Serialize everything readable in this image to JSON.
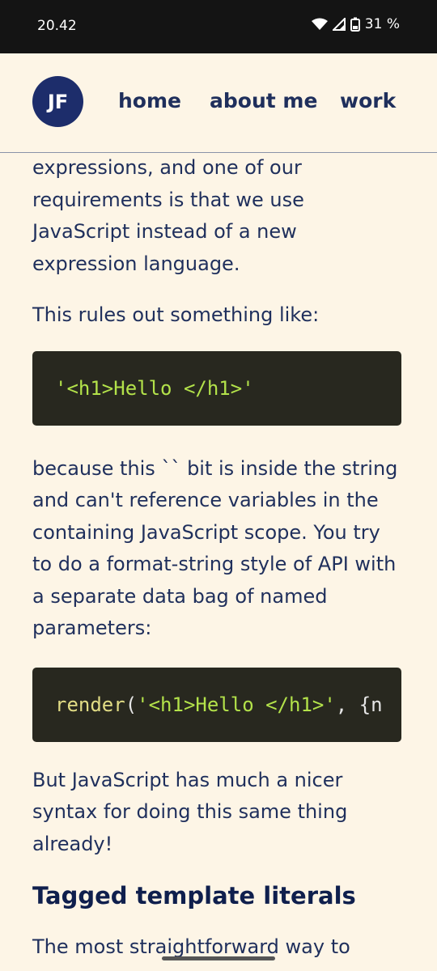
{
  "status_bar": {
    "time": "20.42",
    "battery": "31 %"
  },
  "header": {
    "avatar": "JF",
    "nav": [
      {
        "label": "home"
      },
      {
        "label": "about me"
      },
      {
        "label": "work"
      }
    ]
  },
  "article": {
    "p1": "expressions, and one of our requirements is that we use JavaScript instead of a new expression language.",
    "p2": "This rules out something like:",
    "code1": "'<h1>Hello </h1>'",
    "p3": "because this `` bit is inside the string and can't reference variables in the containing JavaScript scope. You try to do a format-string style of API with a separate data bag of named parameters:",
    "code2": {
      "fn": "render",
      "open": "(",
      "str": "'<h1>Hello </h1>'",
      "rest": ", {n"
    },
    "p4": "But JavaScript has much a nicer syntax for doing this same thing already!",
    "h2": "Tagged template literals",
    "p5": "The most straightforward way to"
  }
}
